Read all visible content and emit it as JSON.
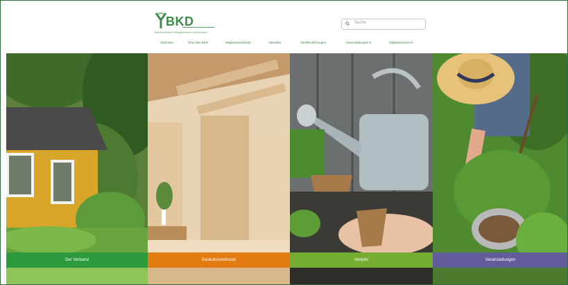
{
  "brand": {
    "name": "BKD",
    "tagline": "Bundesverband Kleingartenwesen Deutschland",
    "color": "#3d8c4a"
  },
  "search": {
    "placeholder": "Suche"
  },
  "nav": {
    "items": [
      "Startseite",
      "Über den BKD",
      "Mitgliedsverbände",
      "Aktuelles",
      "Veröffentlichungen",
      "Veranstaltungen ▾",
      "Mitgliederbereich"
    ]
  },
  "panels": [
    {
      "label": "Der Verband",
      "label_color": "#2e9a3e"
    },
    {
      "label": "Baukulturwerkstatt",
      "label_color": "#e27b10"
    },
    {
      "label": "Verkehr",
      "label_color": "#74ad2f"
    },
    {
      "label": "Veranstaltungen",
      "label_color": "#615d9a"
    }
  ]
}
